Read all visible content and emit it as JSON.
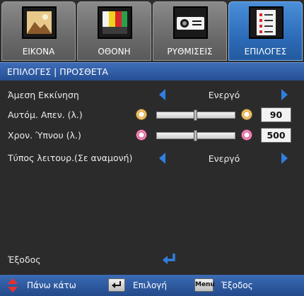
{
  "tabs": [
    {
      "label": "ΕΙΚΟΝΑ",
      "icon": "picture-icon",
      "active": false
    },
    {
      "label": "ΟΘΟΝΗ",
      "icon": "display-color-bars-icon",
      "active": false
    },
    {
      "label": "ΡΥΘΜΙΣΕΙΣ",
      "icon": "projector-icon",
      "active": false
    },
    {
      "label": "ΕΠΙΛΟΓΕΣ",
      "icon": "checklist-icon",
      "active": true
    }
  ],
  "header": {
    "title": "ΕΠΙΛΟΓΕΣ | ΠΡΟΣΘΕΤΑ"
  },
  "rows": {
    "direct_power_on": {
      "label": "Άμεση Εκκίνηση",
      "value": "Ενεργό"
    },
    "auto_power_off": {
      "label": "Αυτόμ. Απεν. (λ.)",
      "value": "90",
      "level": 0.5
    },
    "sleep_timer": {
      "label": "Χρον. Ύπνου (λ.)",
      "value": "500",
      "level": 0.5
    },
    "power_mode": {
      "label": "Τύπος λειτουρ.(Σε αναμονή)",
      "value": "Ενεργό"
    },
    "exit": {
      "label": "Έξοδος"
    }
  },
  "footer": {
    "nav_label": "Πάνω κάτω",
    "enter_label": "Επιλογή",
    "menu_key": "Menu",
    "menu_label": "Έξοδος"
  },
  "colors": {
    "accent": "#2f7fe0",
    "active_tab": "#2d6cb8",
    "header": "#264f93"
  }
}
